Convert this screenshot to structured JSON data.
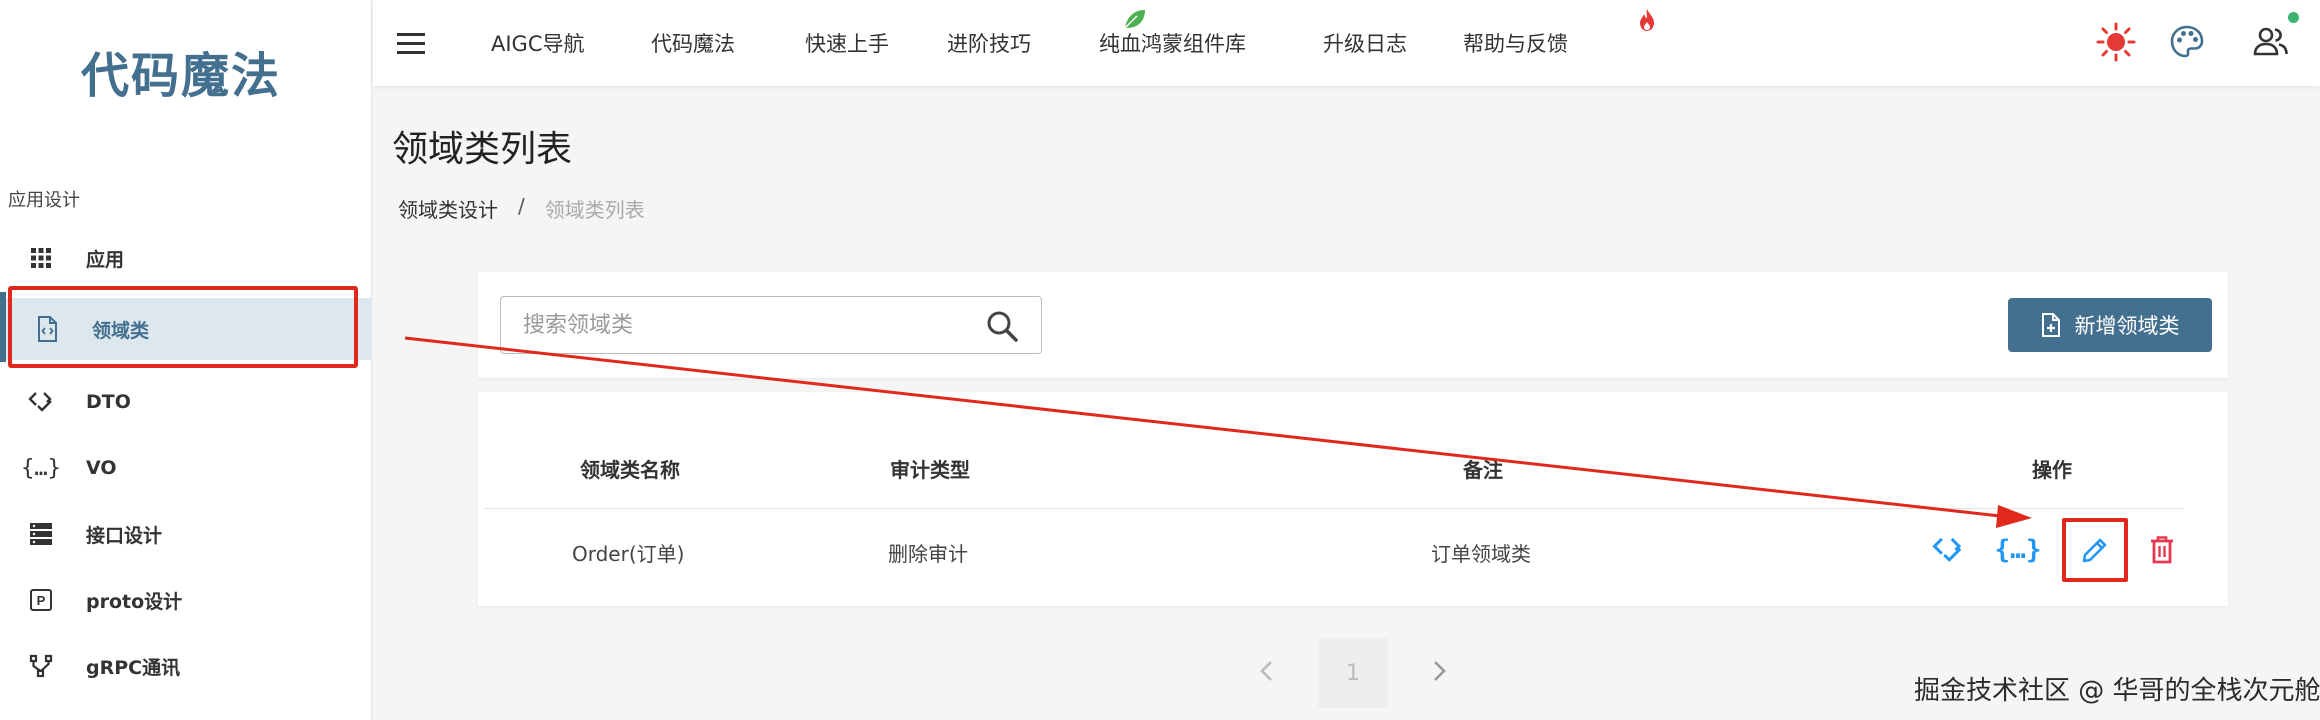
{
  "brand": {
    "logo": "代码魔法",
    "accent": "#44708f",
    "annotation_color": "#e0281d"
  },
  "sidebar": {
    "section_title": "应用设计",
    "items": [
      {
        "label": "应用",
        "icon": "grid-icon"
      },
      {
        "label": "领域类",
        "icon": "code-file-icon",
        "active": true
      },
      {
        "label": "DTO",
        "icon": "code-check-icon"
      },
      {
        "label": "VO",
        "icon": "braces-icon"
      },
      {
        "label": "接口设计",
        "icon": "server-icon"
      },
      {
        "label": "proto设计",
        "icon": "p-box-icon"
      },
      {
        "label": "gRPC通讯",
        "icon": "fork-icon"
      }
    ]
  },
  "header": {
    "nav": [
      {
        "label": "AIGC导航"
      },
      {
        "label": "代码魔法",
        "badge": "leaf-icon"
      },
      {
        "label": "快速上手"
      },
      {
        "label": "进阶技巧"
      },
      {
        "label": "纯血鸿蒙组件库",
        "badge": "fire-icon"
      },
      {
        "label": "升级日志"
      },
      {
        "label": "帮助与反馈"
      }
    ],
    "right_icons": [
      "sun-icon",
      "palette-icon",
      "users-icon"
    ],
    "online_status_color": "#3cb371"
  },
  "page": {
    "title": "领域类列表",
    "breadcrumb": {
      "parent": "领域类设计",
      "separator": "/",
      "current": "领域类列表"
    }
  },
  "search": {
    "placeholder": "搜索领域类",
    "value": ""
  },
  "add_button": {
    "label": "新增领域类"
  },
  "table": {
    "columns": [
      "领域类名称",
      "审计类型",
      "备注",
      "操作"
    ],
    "rows": [
      {
        "name": "Order(订单)",
        "audit_type": "删除审计",
        "remark": "订单领域类",
        "actions": [
          "code-check-icon",
          "braces-icon",
          "pencil-icon",
          "trash-icon"
        ]
      }
    ]
  },
  "pagination": {
    "current_page": "1"
  },
  "watermark": "掘金技术社区 @ 华哥的全栈次元舱"
}
